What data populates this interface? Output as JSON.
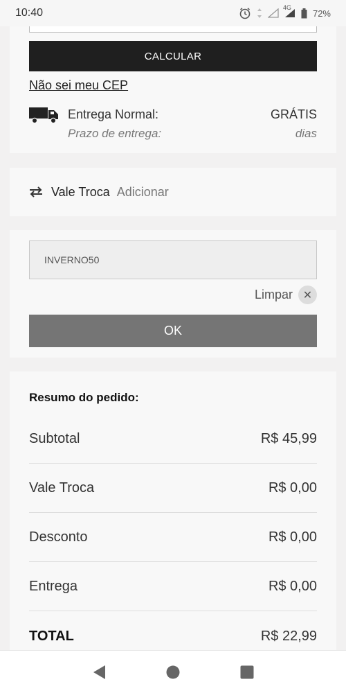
{
  "status_bar": {
    "time": "10:40",
    "network": "4G",
    "battery": "72%"
  },
  "shipping": {
    "calculate_label": "CALCULAR",
    "unknown_cep_link": "Não sei meu CEP",
    "delivery_label": "Entrega Normal:",
    "delivery_value": "GRÁTIS",
    "term_label": "Prazo de entrega:",
    "term_value": "dias"
  },
  "vale_troca": {
    "title": "Vale Troca",
    "add_label": "Adicionar"
  },
  "coupon": {
    "value": "INVERNO50",
    "clear_label": "Limpar",
    "ok_label": "OK"
  },
  "summary": {
    "title": "Resumo do pedido:",
    "rows": [
      {
        "label": "Subtotal",
        "value": "R$ 45,99"
      },
      {
        "label": "Vale Troca",
        "value": "R$ 0,00"
      },
      {
        "label": "Desconto",
        "value": "R$ 0,00"
      },
      {
        "label": "Entrega",
        "value": "R$ 0,00"
      },
      {
        "label": "TOTAL",
        "value": "R$ 22,99"
      }
    ]
  },
  "icons": {
    "alarm": "alarm-icon",
    "signal": "signal-icon",
    "battery": "battery-icon",
    "truck": "truck-icon",
    "swap": "swap-arrows-icon",
    "close": "close-icon",
    "back": "back-icon",
    "home": "home-icon",
    "recents": "recents-icon"
  },
  "colors": {
    "dark_button": "#1f1f1f",
    "ok_button": "#757575",
    "background": "#f2f1f1"
  }
}
